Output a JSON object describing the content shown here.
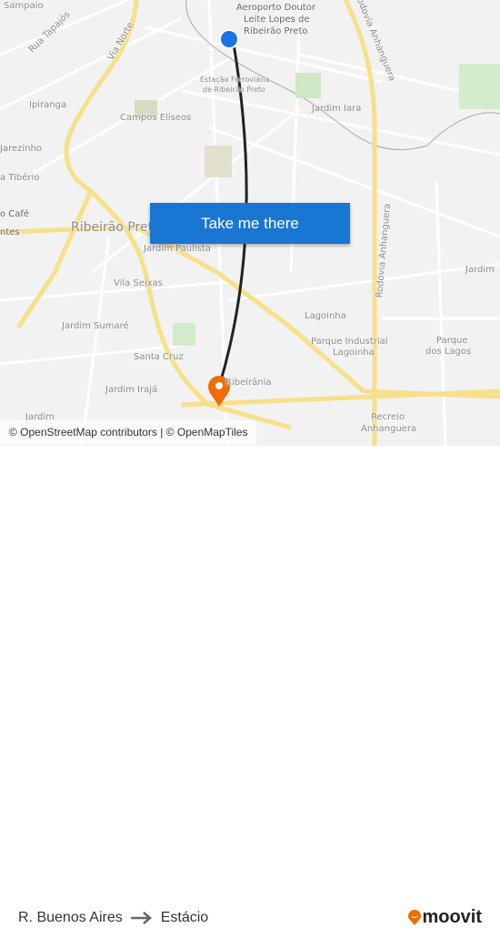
{
  "map": {
    "labels": [
      "Sampaio",
      "Rua Tapajós",
      "Via Norte",
      "Aeroporto Doutor",
      "Leite Lopes de",
      "Ribeirão Preto",
      "Rodovia Anhanguera",
      "Estação Ferroviária",
      "de Ribeirão Preto",
      "Ipiranga",
      "Campos Elíseos",
      "Jardim Iara",
      "Jarezinho",
      "a Tibério",
      "o Café",
      "ntes",
      "Ribeirão Preto",
      "Jardim Paulista",
      "Rodovia Anhanguera",
      "Jardim",
      "Vila Seixas",
      "Lagoinha",
      "Jardim Sumaré",
      "Parque Industrial",
      "Lagoinha",
      "Parque",
      "dos Lagos",
      "Santa Cruz",
      "Ribeirânia",
      "Jardim Irajá",
      "Jardim",
      "Recreio",
      "Anhanguera"
    ],
    "route_color": "#222222",
    "origin_color": "#1a73e8",
    "destination_color": "#f26c00",
    "road_color": "#f7e08a",
    "attribution": "© OpenStreetMap contributors | © OpenMapTiles"
  },
  "cta": {
    "label": "Take me there",
    "color": "#1976d2"
  },
  "footer": {
    "origin": "R. Buenos Aires",
    "destination": "Estácio",
    "arrow_icon": "arrow-right",
    "brand": "moovit",
    "brand_color": "#f26c00"
  }
}
